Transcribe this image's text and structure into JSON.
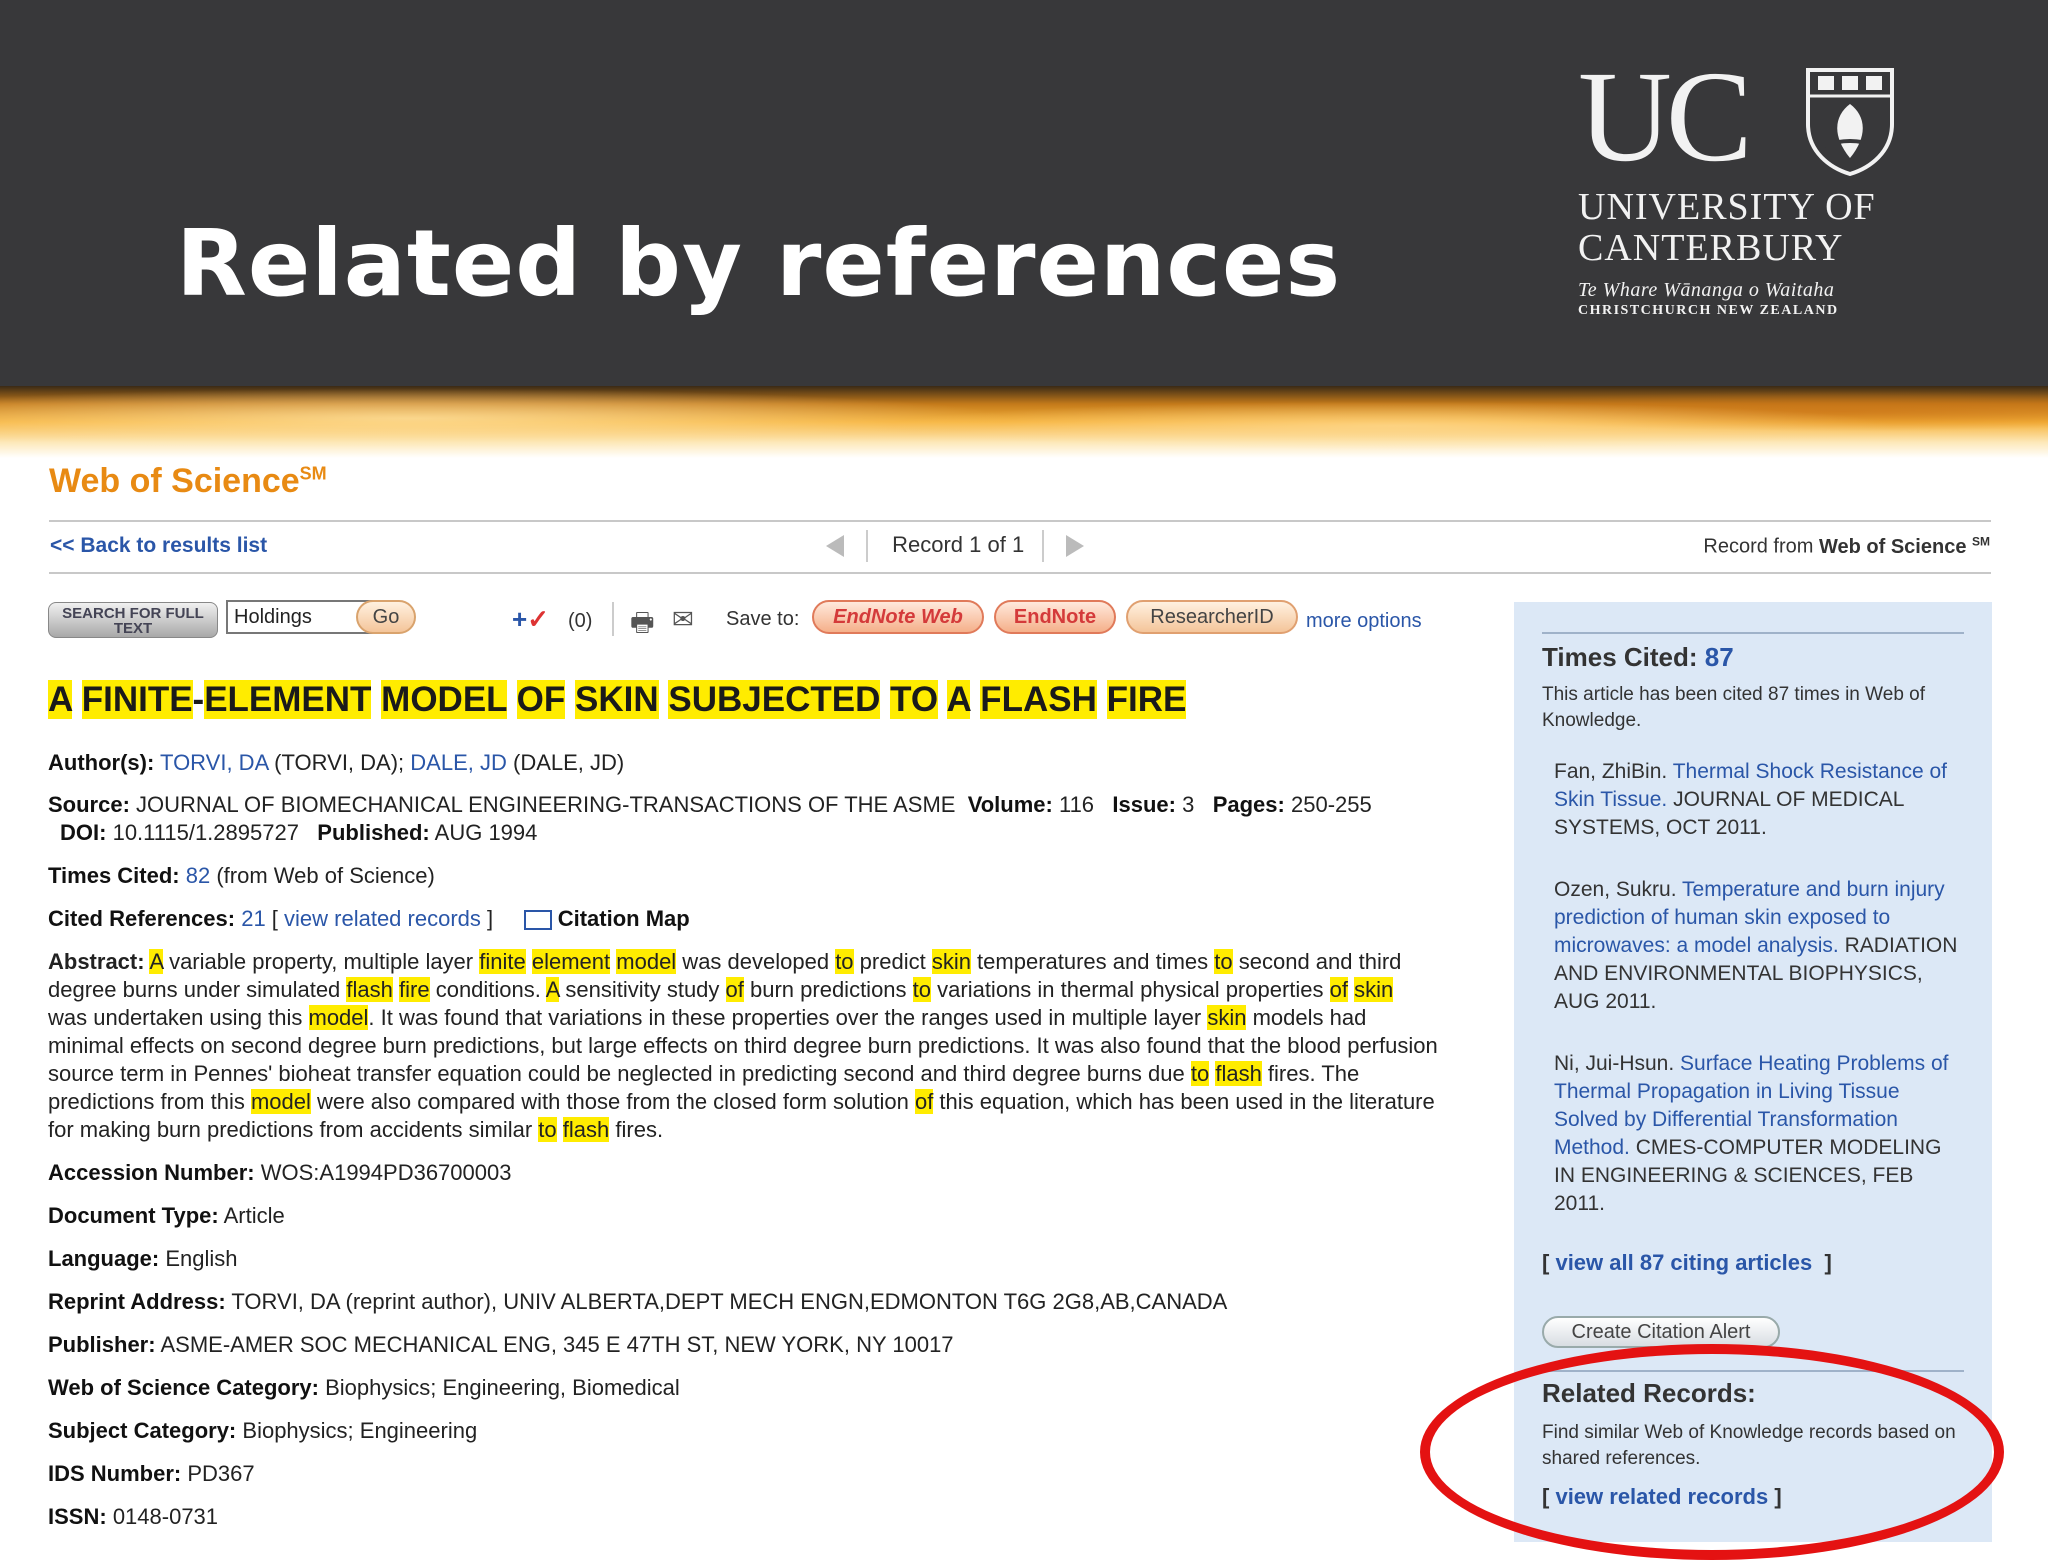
{
  "slide": {
    "title": "Related by references",
    "logo": {
      "letters": "UC",
      "line1": "UNIVERSITY OF",
      "line2": "CANTERBURY",
      "maori": "Te Whare Wānanga o Waitaha",
      "city": "CHRISTCHURCH NEW ZEALAND"
    }
  },
  "wos": {
    "brand": "Web of Science",
    "brand_sup": "SM",
    "nav": {
      "back": "<< Back to results list",
      "record": "Record 1 of 1",
      "record_from_prefix": "Record from",
      "record_from_source": "Web of Science",
      "record_from_sup": "SM"
    },
    "toolbar": {
      "search_full_text": "SEARCH FOR FULL TEXT",
      "holdings_value": "Holdings",
      "go_label": "Go",
      "marked_count": "(0)",
      "save_to": "Save to:",
      "endnote_web": "EndNote Web",
      "endnote": "EndNote",
      "researcherid": "ResearcherID",
      "more_options": "more options"
    },
    "article": {
      "title_words": [
        "A",
        "FINITE",
        "-",
        "ELEMENT",
        "MODEL",
        "OF",
        "SKIN",
        "SUBJECTED",
        "TO",
        "A",
        "FLASH",
        "FIRE"
      ],
      "authors_label": "Author(s):",
      "authors": [
        {
          "link": "TORVI, DA",
          "full": "(TORVI, DA)"
        },
        {
          "link": "DALE, JD",
          "full": "(DALE, JD)"
        }
      ],
      "source_label": "Source:",
      "source": "JOURNAL OF BIOMECHANICAL ENGINEERING-TRANSACTIONS OF THE ASME",
      "volume_label": "Volume:",
      "volume": "116",
      "issue_label": "Issue:",
      "issue": "3",
      "pages_label": "Pages:",
      "pages": "250-255",
      "doi_label": "DOI:",
      "doi": "10.1115/1.2895727",
      "published_label": "Published:",
      "published": "AUG 1994",
      "times_cited_label": "Times Cited:",
      "times_cited": "82",
      "times_cited_suffix": "(from Web of Science)",
      "cited_refs_label": "Cited References:",
      "cited_refs": "21",
      "view_related": "view related records",
      "citation_map": "Citation Map",
      "abstract_label": "Abstract:",
      "abstract_segments": [
        {
          "t": "A",
          "h": true
        },
        {
          "t": " variable property, multiple layer ",
          "h": false
        },
        {
          "t": "finite",
          "h": true
        },
        {
          "t": " ",
          "h": false
        },
        {
          "t": "element",
          "h": true
        },
        {
          "t": " ",
          "h": false
        },
        {
          "t": "model",
          "h": true
        },
        {
          "t": " was developed ",
          "h": false
        },
        {
          "t": "to",
          "h": true
        },
        {
          "t": " predict ",
          "h": false
        },
        {
          "t": "skin",
          "h": true
        },
        {
          "t": " temperatures and times ",
          "h": false
        },
        {
          "t": "to",
          "h": true
        },
        {
          "t": " second and third degree burns under simulated ",
          "h": false
        },
        {
          "t": "flash",
          "h": true
        },
        {
          "t": " ",
          "h": false
        },
        {
          "t": "fire",
          "h": true
        },
        {
          "t": " conditions. ",
          "h": false
        },
        {
          "t": "A",
          "h": true
        },
        {
          "t": " sensitivity study ",
          "h": false
        },
        {
          "t": "of",
          "h": true
        },
        {
          "t": " burn predictions ",
          "h": false
        },
        {
          "t": "to",
          "h": true
        },
        {
          "t": " variations in thermal physical properties ",
          "h": false
        },
        {
          "t": "of",
          "h": true
        },
        {
          "t": " ",
          "h": false
        },
        {
          "t": "skin",
          "h": true
        },
        {
          "t": " was undertaken using this ",
          "h": false
        },
        {
          "t": "model",
          "h": true
        },
        {
          "t": ". It was found that variations in these properties over the ranges used in multiple layer ",
          "h": false
        },
        {
          "t": "skin",
          "h": true
        },
        {
          "t": " models had minimal effects on second degree burn predictions, but large effects on third degree burn predictions. It was also found that the blood perfusion source term in Pennes' bioheat transfer equation could be neglected in predicting second and third degree burns due ",
          "h": false
        },
        {
          "t": "to",
          "h": true
        },
        {
          "t": " ",
          "h": false
        },
        {
          "t": "flash",
          "h": true
        },
        {
          "t": " fires. The predictions from this ",
          "h": false
        },
        {
          "t": "model",
          "h": true
        },
        {
          "t": " were also compared with those from the closed form solution ",
          "h": false
        },
        {
          "t": "of",
          "h": true
        },
        {
          "t": " this equation, which has been used in the literature for making burn predictions from accidents similar ",
          "h": false
        },
        {
          "t": "to",
          "h": true
        },
        {
          "t": " ",
          "h": false
        },
        {
          "t": "flash",
          "h": true
        },
        {
          "t": " fires.",
          "h": false
        }
      ],
      "accession_label": "Accession Number:",
      "accession": "WOS:A1994PD36700003",
      "doctype_label": "Document Type:",
      "doctype": "Article",
      "language_label": "Language:",
      "language": "English",
      "reprint_label": "Reprint Address:",
      "reprint": "TORVI, DA (reprint author), UNIV ALBERTA,DEPT MECH ENGN,EDMONTON T6G 2G8,AB,CANADA",
      "publisher_label": "Publisher:",
      "publisher": "ASME-AMER SOC MECHANICAL ENG, 345 E 47TH ST, NEW YORK, NY 10017",
      "wos_category_label": "Web of Science Category:",
      "wos_category": "Biophysics; Engineering, Biomedical",
      "subject_label": "Subject Category:",
      "subject": "Biophysics; Engineering",
      "ids_label": "IDS Number:",
      "ids": "PD367",
      "issn_label": "ISSN:",
      "issn": "0148-0731"
    },
    "sidebar": {
      "times_cited_label": "Times Cited:",
      "times_cited_value": "87",
      "times_cited_desc": "This article has been cited 87 times in Web of Knowledge.",
      "citations": [
        {
          "author": "Fan, ZhiBin.",
          "title": "Thermal Shock Resistance of Skin Tissue.",
          "source": "JOURNAL OF MEDICAL SYSTEMS, OCT 2011."
        },
        {
          "author": "Ozen, Sukru.",
          "title": "Temperature and burn injury prediction of human skin exposed to microwaves: a model analysis.",
          "source": "RADIATION AND ENVIRONMENTAL BIOPHYSICS, AUG 2011."
        },
        {
          "author": "Ni, Jui-Hsun.",
          "title": "Surface Heating Problems of Thermal Propagation in Living Tissue Solved by Differential Transformation Method.",
          "source": "CMES-COMPUTER MODELING IN ENGINEERING & SCIENCES, FEB 2011."
        }
      ],
      "view_all": "view all 87 citing articles",
      "create_alert": "Create Citation Alert",
      "related_label": "Related Records:",
      "related_desc": "Find similar Web of Knowledge records based on shared references.",
      "view_related": "view related records"
    },
    "colors": {
      "brand_orange": "#e88a13",
      "link_blue": "#2a56a8",
      "highlight": "#ffec00",
      "sidebar_bg": "#dce8f6",
      "annotation_red": "#e41212",
      "banner_dark": "#38383a"
    }
  }
}
